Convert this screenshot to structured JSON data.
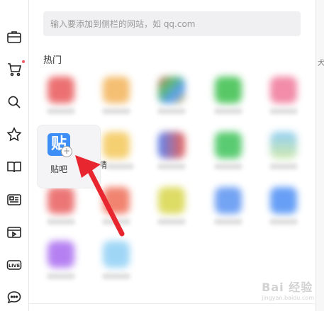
{
  "search": {
    "placeholder": "输入要添加到侧栏的网站，如 qq.com"
  },
  "section": {
    "title": "热门"
  },
  "hover_item": {
    "icon_char": "贴",
    "label": "贴吧",
    "badge": "+"
  },
  "partial_label": "精",
  "right_strip_char": "犬",
  "sidebar_icons": [
    "briefcase-icon",
    "cart-icon",
    "search-icon",
    "star-icon",
    "book-icon",
    "news-icon",
    "video-icon",
    "live-icon",
    "chat-icon"
  ],
  "sidebar_live_text": "LIVE",
  "colors": {
    "accent_blue": "#3d8ef7",
    "arrow_red": "#e8262f",
    "notify_dot": "#f25858"
  },
  "watermark": {
    "text": "Bai 经验",
    "sub": "jingyan.baidu.com"
  }
}
